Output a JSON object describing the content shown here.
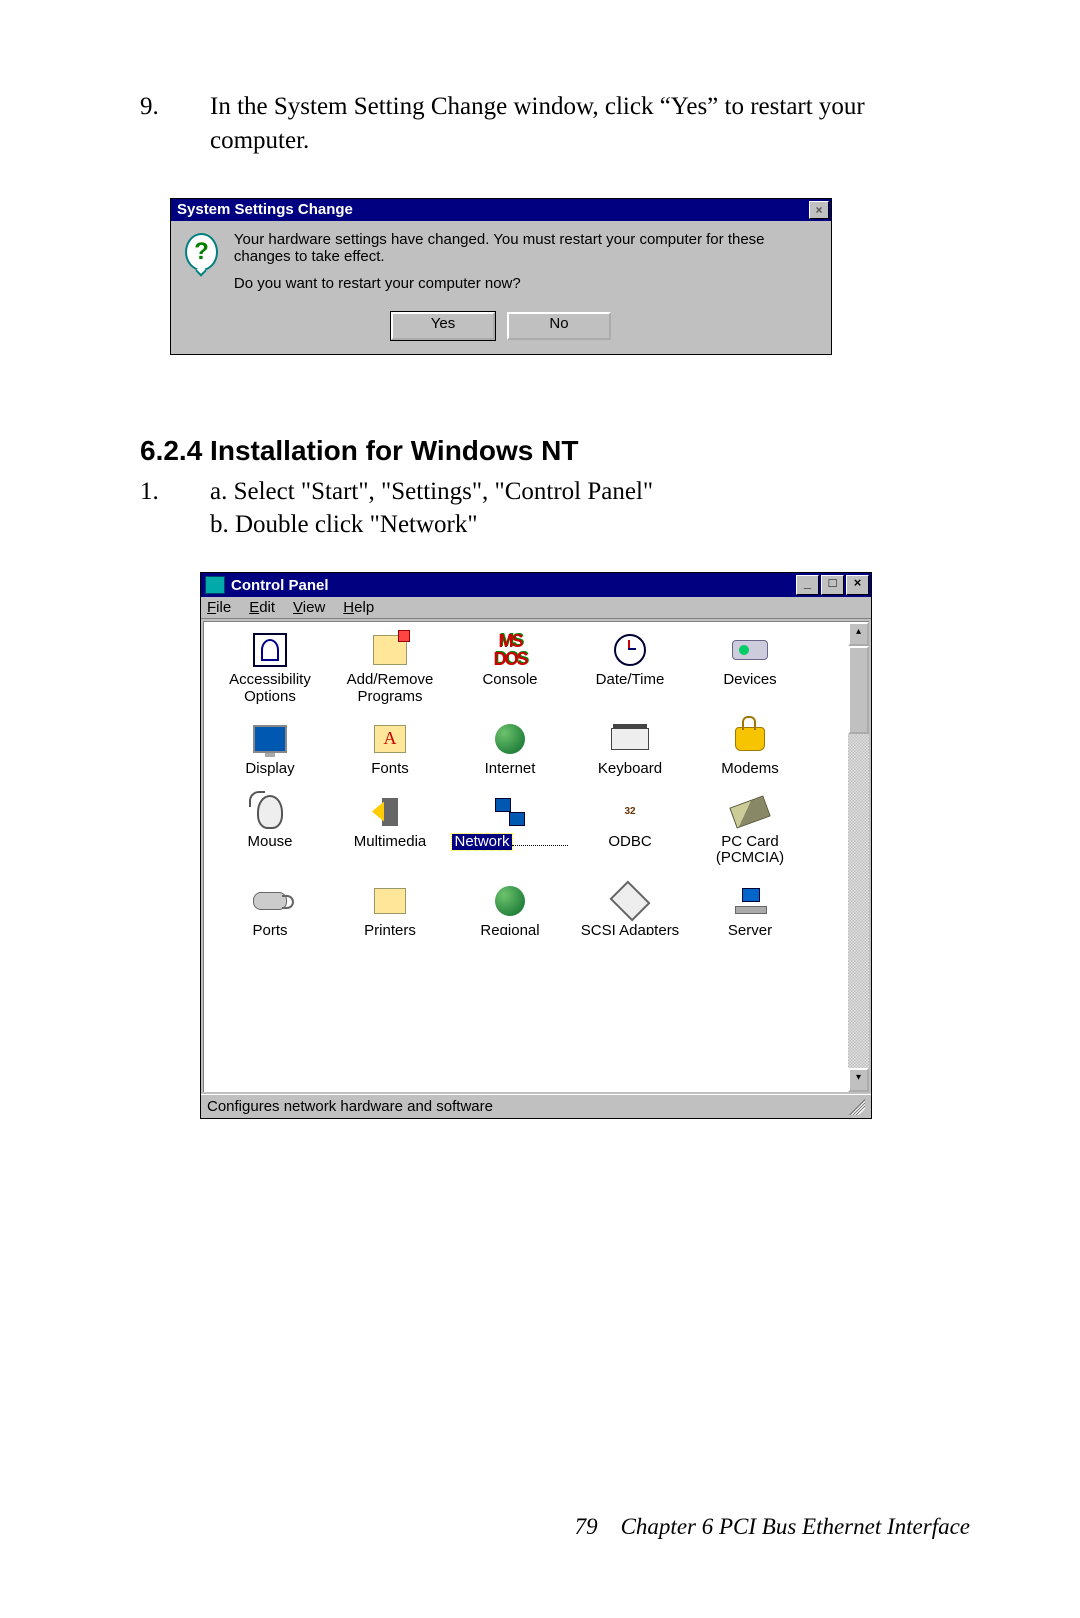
{
  "step9": {
    "number": "9.",
    "text": "In the System Setting Change window, click “Yes” to restart your computer."
  },
  "dialog": {
    "title": "System Settings Change",
    "line1": "Your hardware settings have changed. You must restart your computer for these changes to take effect.",
    "line2": "Do you want to restart your computer now?",
    "yes": "Yes",
    "no": "No"
  },
  "heading": "6.2.4 Installation for Windows NT",
  "step1": {
    "number": "1.",
    "a": "a. Select \"Start\", \"Settings\", \"Control Panel\"",
    "b": "b. Double click \"Network\""
  },
  "cp": {
    "title": "Control Panel",
    "menus": {
      "file": "File",
      "edit": "Edit",
      "view": "View",
      "help": "Help"
    },
    "status": "Configures network hardware and software",
    "icons": {
      "r0": [
        "Accessibility Options",
        "Add/Remove Programs",
        "Console",
        "Date/Time",
        "Devices"
      ],
      "r1": [
        "Display",
        "Fonts",
        "Internet",
        "Keyboard",
        "Modems"
      ],
      "r2": [
        "Mouse",
        "Multimedia",
        "Network",
        "ODBC",
        "PC Card (PCMCIA)"
      ],
      "r3": [
        "Ports",
        "Printers",
        "Regional",
        "SCSI Adapters",
        "Server"
      ]
    },
    "console_glyph": "MS DOS",
    "odbc_glyph": "32"
  },
  "footer": {
    "page": "79",
    "chapter": "Chapter 6  PCI Bus Ethernet Interface"
  }
}
